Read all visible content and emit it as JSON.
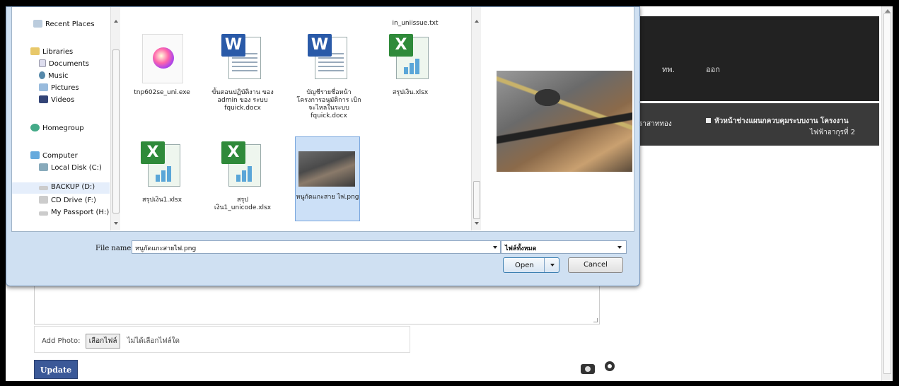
{
  "page": {
    "header_links": [
      "ทพ.",
      "ออก"
    ],
    "bar_text_left": "ไราสาททอง",
    "bar_text_title": "หัวหน้าช่างแผนกควบคุมระบบงาน โครงงาน",
    "bar_text_sub": "ไฟฟ้าอากุรที่ 2",
    "add_photo_label": "Add Photo:",
    "choose_file_button": "เลือกไฟล์",
    "no_file_text": "ไม่ได้เลือกไฟล์ใด",
    "update_button": "Update"
  },
  "dialog": {
    "nav_items": [
      "Recent Places",
      "Libraries",
      "Documents",
      "Music",
      "Pictures",
      "Videos",
      "Homegroup",
      "Computer",
      "Local Disk (C:)",
      "BACKUP (D:)",
      "CD Drive (F:)",
      "My Passport (H:)"
    ],
    "selected_nav": "BACKUP (D:)",
    "top_partial_file": "in_uniissue.txt",
    "files": [
      {
        "name": "tnp602se_uni.exe",
        "type": "exe"
      },
      {
        "name": "ขั้นตอนปฏิบัติงาน ของ admin ของ ระบบ fquick.docx",
        "type": "word"
      },
      {
        "name": "บัญชีรายชื่อหน้า โครงการอนุมัติการ เบิกจะไหลในระบบ fquick.docx",
        "type": "word"
      },
      {
        "name": "สรุปเงิน.xlsx",
        "type": "excel"
      },
      {
        "name": "สรุปเงิน1.xlsx",
        "type": "excel"
      },
      {
        "name": "สรุป เงิน1_unicode.xlsx",
        "type": "excel"
      },
      {
        "name": "หนูกัดแกะสาย ไฟ.png",
        "type": "image",
        "selected": true
      }
    ],
    "file_name_label": "File name:",
    "file_name_value": "หนูกัดแกะสายไฟ.png",
    "filter_value": "ไฟล์ทั้งหมด",
    "open_button": "Open",
    "cancel_button": "Cancel"
  },
  "colors": {
    "update_button_bg": "#3b5998",
    "selection_bg": "#cce0f7",
    "dialog_frame": "#cfe0f2"
  }
}
